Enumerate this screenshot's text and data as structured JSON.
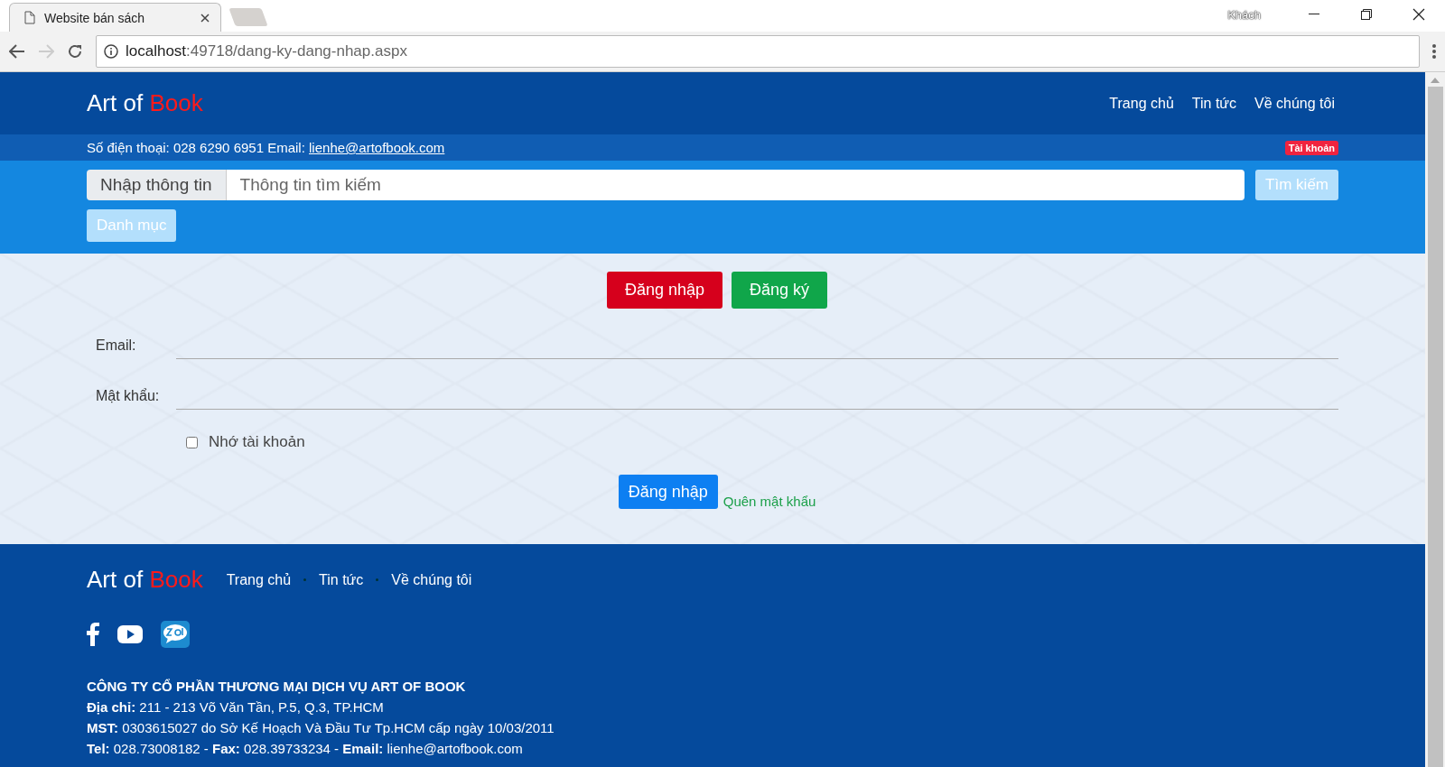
{
  "browser": {
    "tab_title": "Website bán sách",
    "profile": "Khách",
    "url_host": "localhost",
    "url_path": ":49718/dang-ky-dang-nhap.aspx"
  },
  "header": {
    "brand": {
      "prefix": "Art of",
      "highlight": "Book"
    },
    "nav": [
      "Trang chủ",
      "Tin tức",
      "Về chúng tôi"
    ]
  },
  "info_bar": {
    "text": "Số điện thoại: 028 6290 6951 Email:",
    "email_link": "lienhe@artofbook.com",
    "account_badge": "Tài khoản"
  },
  "search": {
    "addon": "Nhập thông tin",
    "placeholder": "Thông tin tìm kiếm",
    "button": "Tìm kiếm",
    "category_button": "Danh mục"
  },
  "auth_tabs": [
    {
      "label": "Đăng nhập",
      "kind": "login"
    },
    {
      "label": "Đăng ký",
      "kind": "register"
    }
  ],
  "form": {
    "fields": [
      {
        "label": "Email:"
      },
      {
        "label": "Mật khẩu:"
      }
    ],
    "remember": {
      "label": "Nhớ tài khoản",
      "checked": false
    },
    "submit": "Đăng nhập",
    "forgot_link": "Quên mật khẩu"
  },
  "footer": {
    "brand": {
      "prefix": "Art of",
      "highlight": "Book"
    },
    "nav": [
      "Trang chủ",
      "Tin tức",
      "Về chúng tôi"
    ],
    "company": "CÔNG TY CỔ PHẦN THƯƠNG MẠI DỊCH VỤ ART OF BOOK",
    "lines": [
      "**Địa chỉ:** 211 - 213 Võ Văn Tần, P.5, Q.3, TP.HCM",
      "**MST:** 0303615027 do Sở Kế Hoạch Và Đầu Tư Tp.HCM cấp ngày 10/03/2011",
      "**Tel:** 028.73008182 - **Fax:** 028.39733234 - **Email:** lienhe@artofbook.com"
    ]
  }
}
